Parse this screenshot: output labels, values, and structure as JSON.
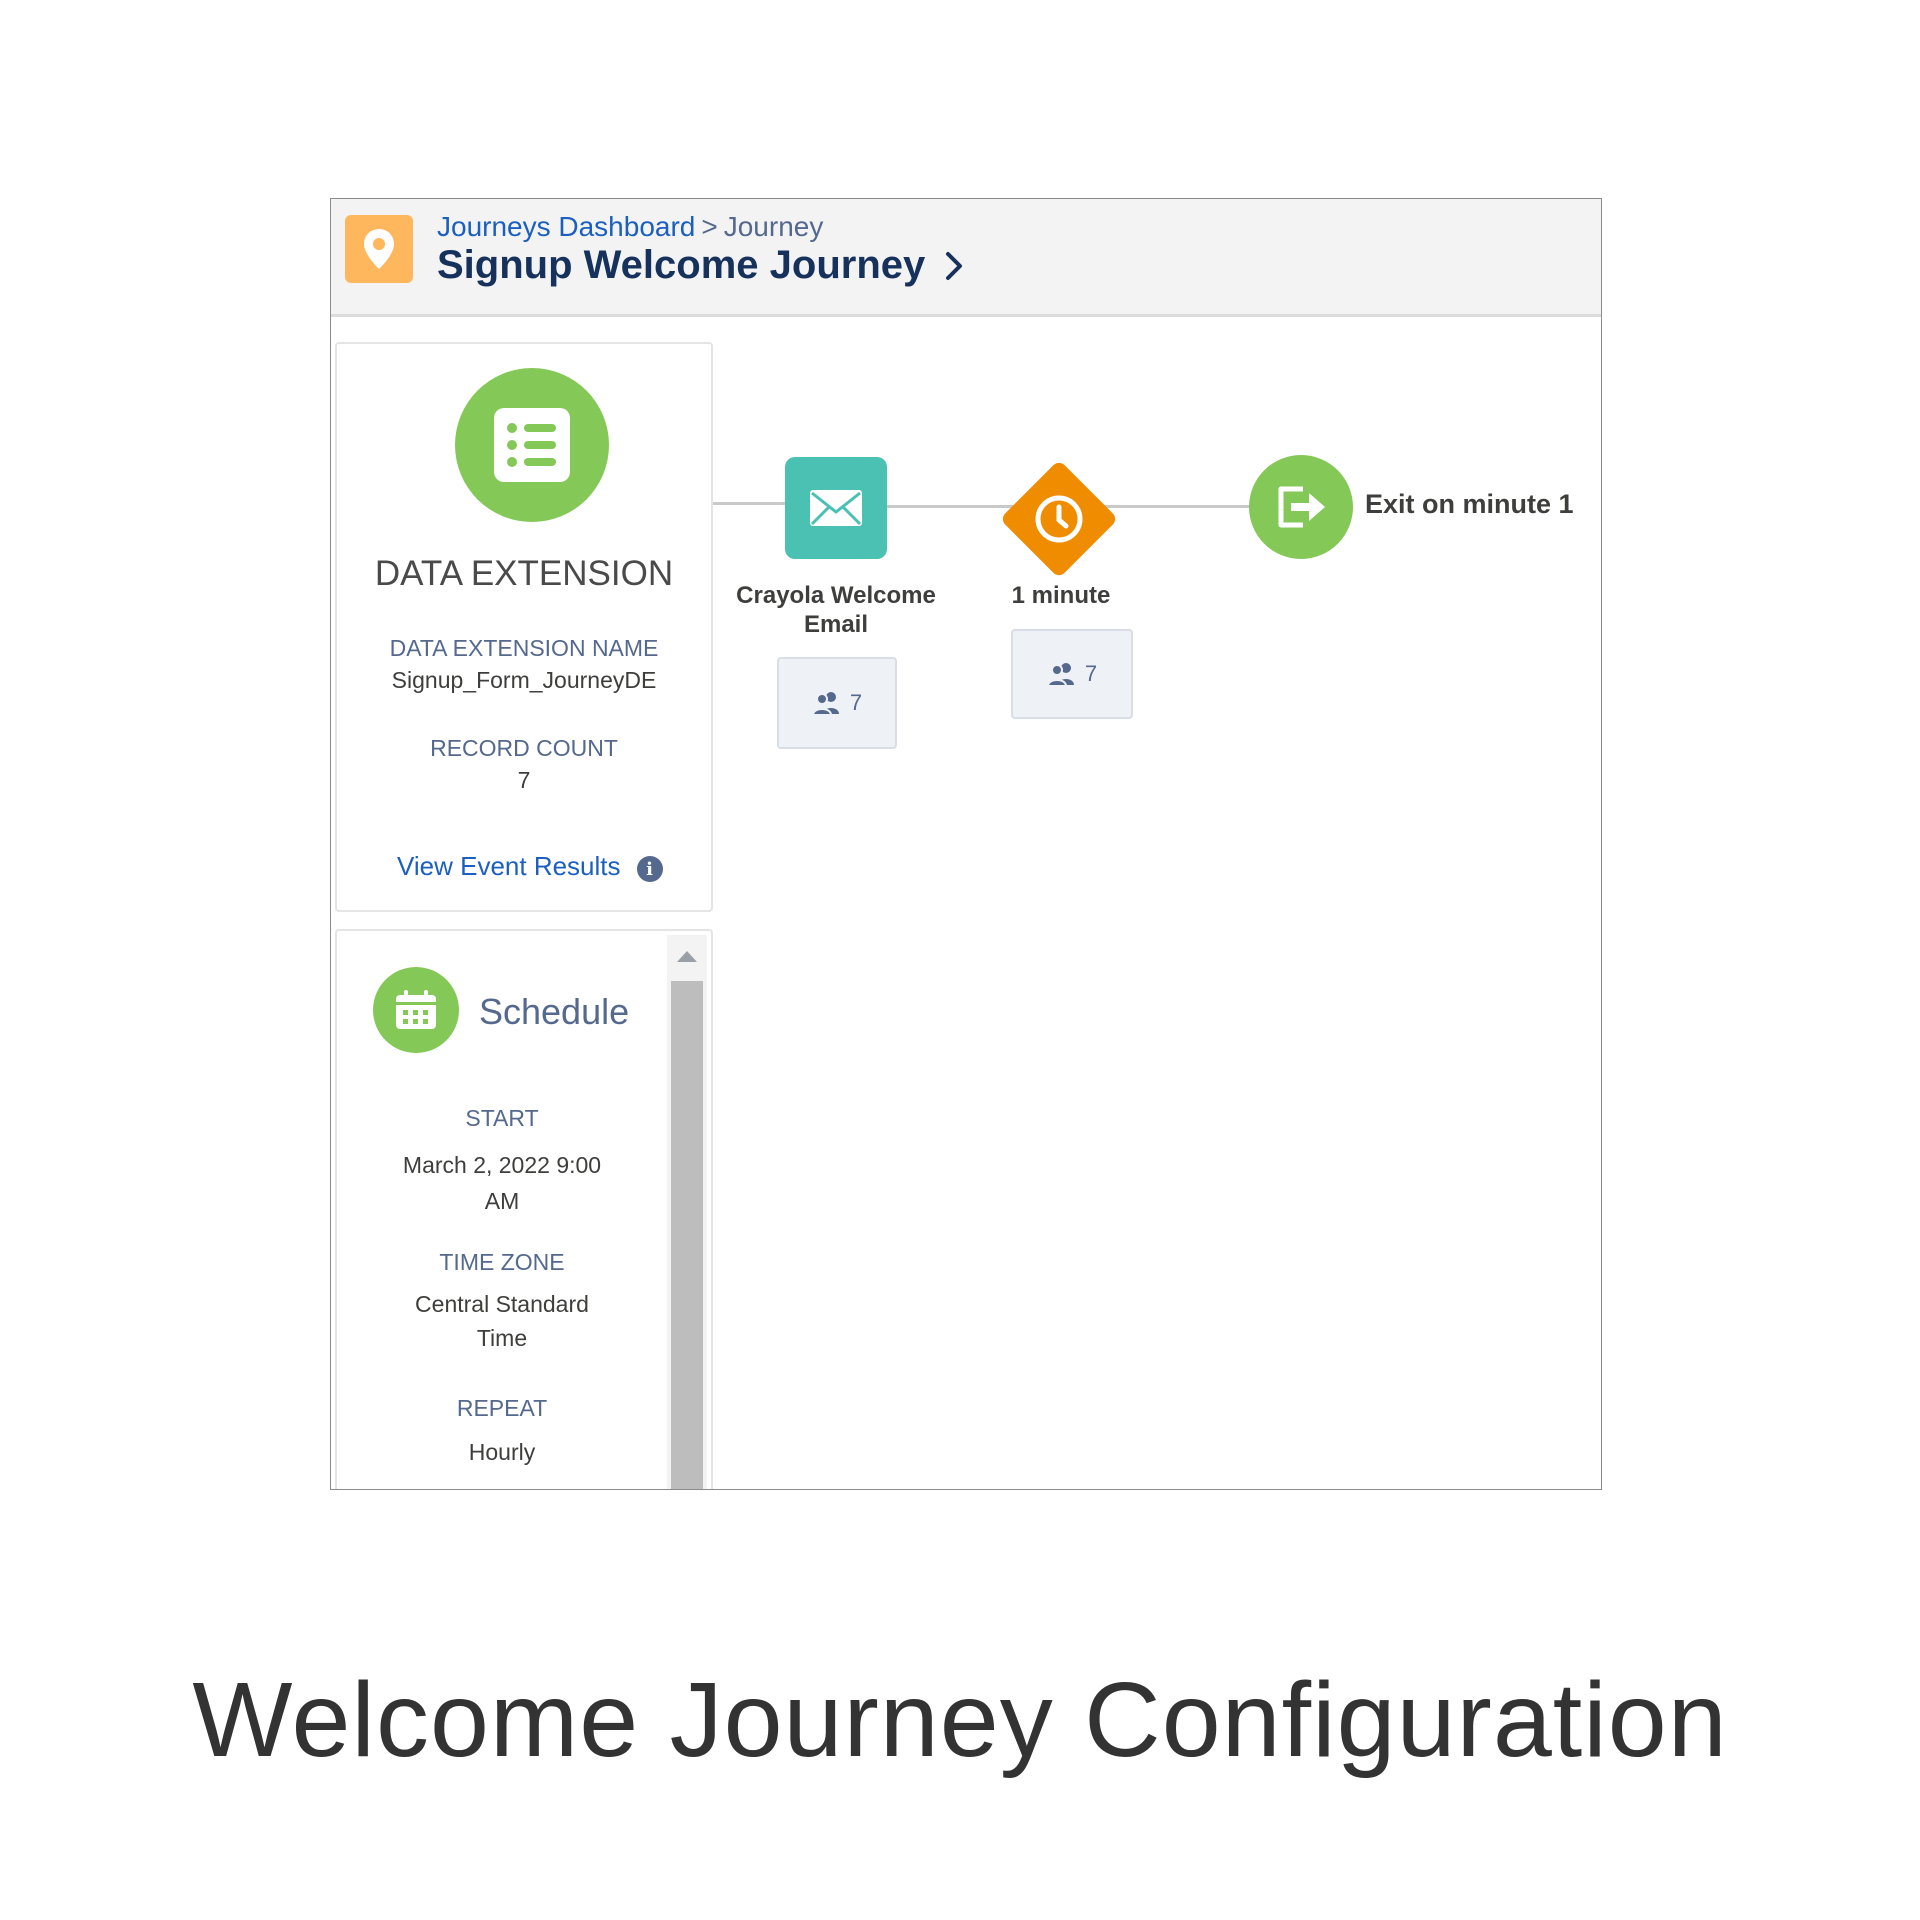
{
  "header": {
    "breadcrumb_link": "Journeys Dashboard",
    "breadcrumb_separator": ">",
    "breadcrumb_current": "Journey",
    "title": "Signup Welcome Journey",
    "icon": "map-pin-icon"
  },
  "data_extension": {
    "heading": "DATA EXTENSION",
    "name_label": "DATA EXTENSION NAME",
    "name_value": "Signup_Form_JourneyDE",
    "record_count_label": "RECORD COUNT",
    "record_count_value": "7",
    "view_link": "View Event Results",
    "info_icon_glyph": "i",
    "icon": "list-icon"
  },
  "schedule": {
    "title": "Schedule",
    "start_label": "START",
    "start_value": "March 2, 2022 9:00 AM",
    "timezone_label": "TIME ZONE",
    "timezone_value": "Central Standard Time",
    "repeat_label": "REPEAT",
    "repeat_value": "Hourly",
    "icon": "calendar-icon"
  },
  "canvas": {
    "email_activity": {
      "label": "Crayola Welcome Email",
      "count": "7",
      "icon": "envelope-icon"
    },
    "wait_activity": {
      "label": "1 minute",
      "count": "7",
      "icon": "clock-icon"
    },
    "exit": {
      "label": "Exit on minute 1",
      "icon": "exit-icon"
    }
  },
  "caption": "Welcome Journey Configuration",
  "colors": {
    "green": "#84c857",
    "teal": "#4bc1b4",
    "orange": "#f08c00",
    "pin_orange": "#ffb75d",
    "link_blue": "#1b5fbf"
  }
}
